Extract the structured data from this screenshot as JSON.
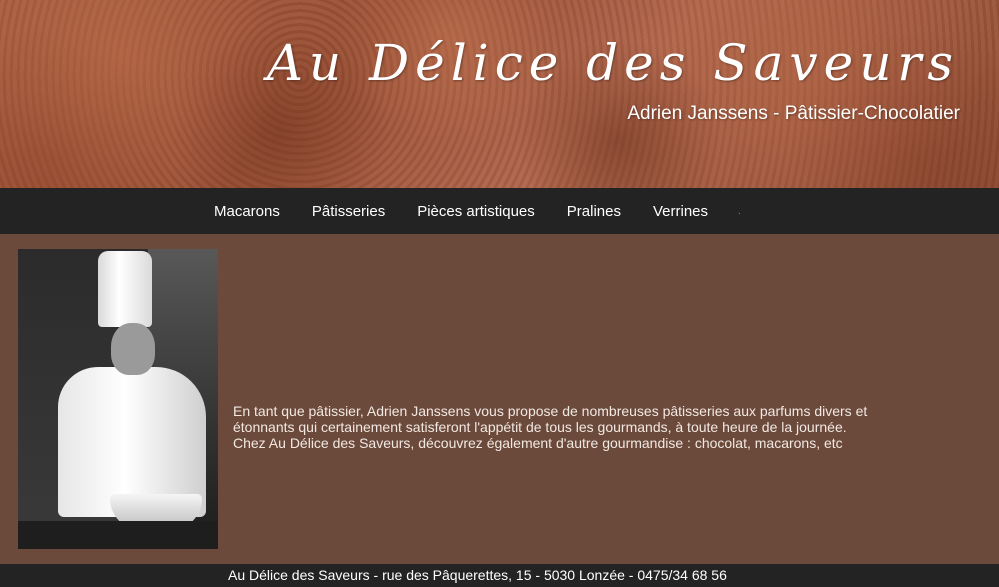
{
  "header": {
    "brand": "Au Délice des Saveurs",
    "subtitle": "Adrien Janssens - Pâtissier-Chocolatier"
  },
  "nav": {
    "items": [
      "Macarons",
      "Pâtisseries",
      "Pièces artistiques",
      "Pralines",
      "Verrines"
    ]
  },
  "intro": {
    "line1": "En tant que pâtissier, Adrien Janssens vous propose de nombreuses pâtisseries aux parfums divers et",
    "line2": "étonnants qui certainement satisferont l'appétit de tous les gourmands, à toute heure de la journée.",
    "line3": "Chez Au Délice des Saveurs, découvrez également d'autre gourmandise : chocolat, macarons, etc"
  },
  "footer": {
    "text": "Au Délice des Saveurs - rue des Pâquerettes, 15 - 5030 Lonzée - 0475/34 68 56"
  },
  "colors": {
    "background": "#6b4a3c",
    "bars": "#232323",
    "text": "#ffffff"
  }
}
